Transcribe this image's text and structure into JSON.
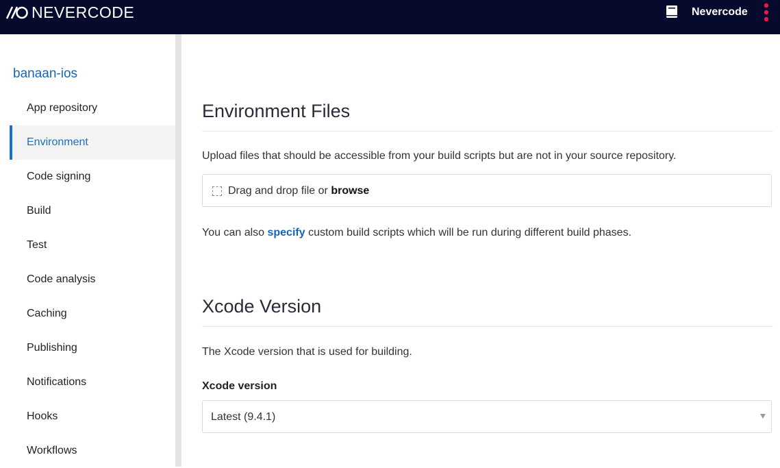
{
  "header": {
    "logo_text": "NEVERCODE",
    "user_name": "Nevercode",
    "colors": {
      "bar": "#060a2d",
      "menu_dots": "#e8174a"
    },
    "icons": [
      "docs-book-icon",
      "more-vertical-icon"
    ]
  },
  "sidebar": {
    "project": "banaan-ios",
    "items": [
      {
        "label": "App repository"
      },
      {
        "label": "Environment",
        "active": true
      },
      {
        "label": "Code signing"
      },
      {
        "label": "Build"
      },
      {
        "label": "Test"
      },
      {
        "label": "Code analysis"
      },
      {
        "label": "Caching"
      },
      {
        "label": "Publishing"
      },
      {
        "label": "Notifications"
      },
      {
        "label": "Hooks"
      },
      {
        "label": "Workflows"
      }
    ]
  },
  "env_files": {
    "title": "Environment Files",
    "description": "Upload files that should be accessible from your build scripts but are not in your source repository.",
    "dropzone_text": "Drag and drop file or ",
    "dropzone_link": "browse",
    "note_prefix": "You can also ",
    "note_link": "specify",
    "note_suffix": " custom build scripts which will be run during different build phases."
  },
  "xcode": {
    "title": "Xcode Version",
    "description": "The Xcode version that is used for building.",
    "field_label": "Xcode version",
    "selected": "Latest (9.4.1)"
  }
}
